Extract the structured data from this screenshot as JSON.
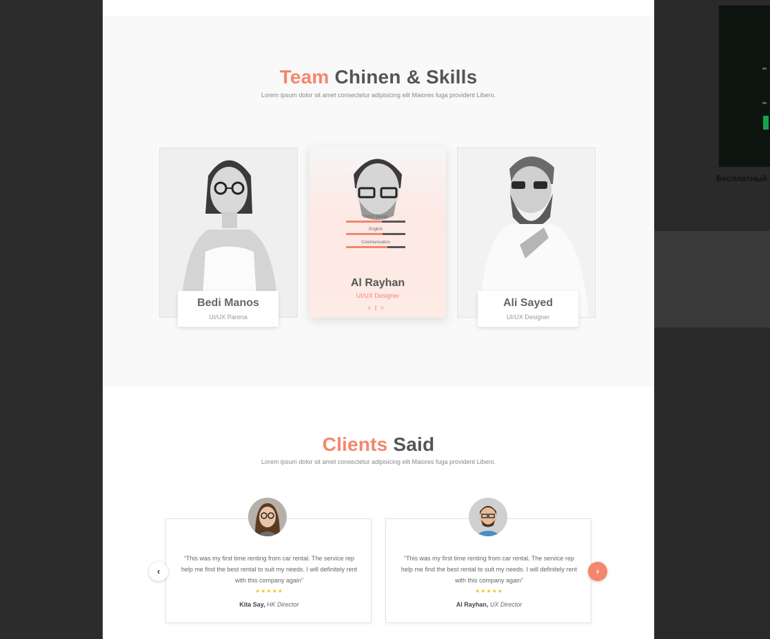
{
  "team": {
    "title_accent": "Team",
    "title_rest": "Chinen & Skills",
    "subtitle": "Lorem ipsum dolor sit amet consectetur adipisicing elit Maiores fuga provident Libero.",
    "members": [
      {
        "name": "Bedi Manos",
        "role": "UI/UX Parena"
      },
      {
        "name": "Al Rayhan",
        "role": "UI/UX Designer",
        "skills": [
          {
            "label": "UI/UX  Design",
            "level": 0.6
          },
          {
            "label": "English",
            "level": 0.62
          },
          {
            "label": "Communication",
            "level": 0.7
          }
        ]
      },
      {
        "name": "Ali Sayed",
        "role": "UI/UX Designer"
      }
    ]
  },
  "clients": {
    "title_accent": "Clients",
    "title_rest": "Said",
    "subtitle": "Lorem ipsum dolor sit amet consectetur adipisicing elit Maiores fuga provident Libero.",
    "prev_icon": "chevron-left-icon",
    "next_icon": "chevron-right-icon",
    "testimonials": [
      {
        "quote": "“This was my first time renting from car rental. The service rep help me find the best rental to suit my needs. I will definitely rent with this company again”",
        "stars": "★★★★★",
        "name": "Kita Say,",
        "title": "HK Director"
      },
      {
        "quote": "“This was my first time renting from car rental. The service rep help me find the best rental to suit my needs. I will definitely rent with this company again”",
        "stars": "★★★★★",
        "name": "Al Rayhan,",
        "title": "UX Director"
      }
    ]
  },
  "sidebar_ad": {
    "caption": "Бесплатный"
  },
  "colors": {
    "accent": "#f4866b",
    "star": "#f5c518",
    "backdrop": "#2c2c2c"
  }
}
